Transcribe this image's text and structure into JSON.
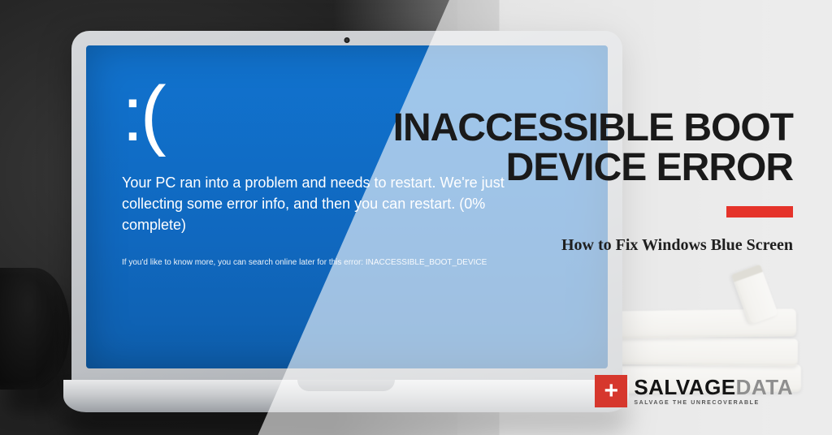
{
  "bsod": {
    "face": ":(",
    "message": "Your PC ran into a problem and needs to restart. We're just collecting some error info, and then you can restart. (0% complete)",
    "detail": "If you'd like to know more, you can search online later for this error: INACCESSIBLE_BOOT_DEVICE"
  },
  "headline": {
    "line1": "INACCESSIBLE BOOT",
    "line2": "DEVICE ERROR",
    "subhead": "How to Fix Windows Blue Screen"
  },
  "logo": {
    "badge": "+",
    "word1": "SALVAGE",
    "word2": "DATA",
    "tagline": "SALVAGE THE UNRECOVERABLE"
  },
  "colors": {
    "accent": "#e5332a",
    "bsod_blue": "#1068bf"
  }
}
